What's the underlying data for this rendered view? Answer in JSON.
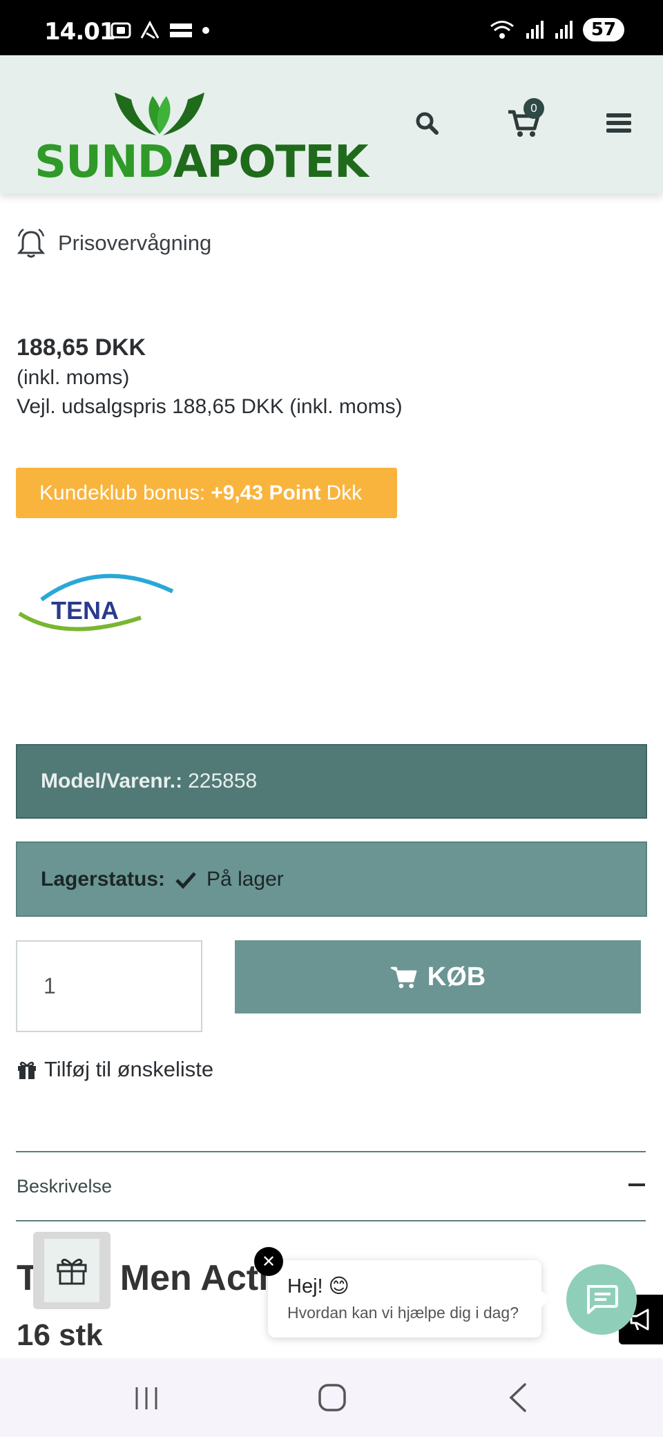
{
  "status_bar": {
    "time": "14.01",
    "battery": "57",
    "icons": [
      "screenshot-icon",
      "arrow-app-icon",
      "temu-icon",
      "dot-icon",
      "wifi-icon",
      "signal-icon",
      "signal-icon-2"
    ]
  },
  "header": {
    "logo_part1": "SUND",
    "logo_part2": "APOTEK",
    "cart_count": "0",
    "colors": {
      "logo_light": "#2f9a28",
      "logo_dark": "#1f6b1b",
      "header_bg": "#e6efec"
    }
  },
  "product": {
    "hidden_title": "Tena Men Active Fit Level 3 16 stk.",
    "price_alert": "Prisovervågning",
    "price": "188,65 DKK",
    "incl_vat": "(inkl. moms)",
    "rrp": "Vejl. udsalgspris 188,65 DKK (inkl. moms)",
    "bonus_prefix": "Kundeklub bonus:",
    "bonus_value": "+9,43 Point",
    "bonus_suffix": "Dkk",
    "brand": "TENA",
    "model_label": "Model/Varenr.:",
    "model_value": "225858",
    "stock_label": "Lagerstatus:",
    "stock_value": "På lager",
    "quantity": "1",
    "buy_label": "KØB",
    "wishlist_label": "Tilføj til ønskeliste",
    "description_label": "Beskrivelse",
    "heading_left": "T",
    "heading_right": "Men Activ",
    "subheading": "16 stk"
  },
  "chat": {
    "greeting": "Hej! 😊",
    "question": "Hvordan kan vi hjælpe dig i dag?",
    "close": "✕"
  },
  "colors": {
    "bonus": "#f9b43d",
    "model_row": "#517a77",
    "stock_row": "#6a9593",
    "buy_button": "#6a9593",
    "chat_fab": "#8fcfb9"
  }
}
